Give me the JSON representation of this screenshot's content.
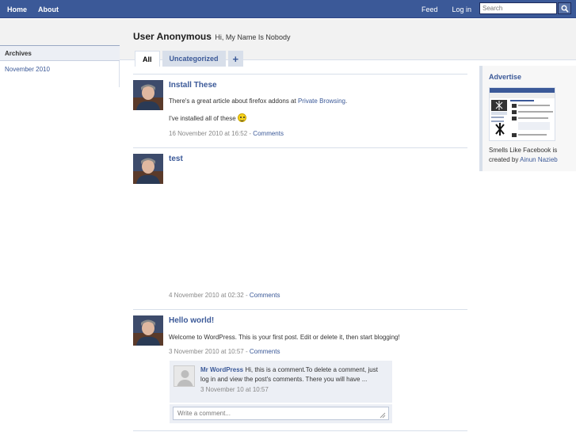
{
  "nav": {
    "home": "Home",
    "about": "About",
    "feed": "Feed",
    "login": "Log in"
  },
  "search": {
    "placeholder": "Search",
    "icon": "search-icon"
  },
  "sidebar": {
    "heading": "Archives",
    "items": [
      {
        "label": "November 2010"
      }
    ]
  },
  "profile": {
    "name": "User Anonymous",
    "tagline": "Hi, My Name Is Nobody"
  },
  "tabs": [
    {
      "label": "All",
      "active": true
    },
    {
      "label": "Uncategorized",
      "active": false
    },
    {
      "label": "+",
      "active": false
    }
  ],
  "posts": [
    {
      "title": "Install These",
      "body_prefix": "There's a great article about firefox addons at ",
      "body_link": "Private Browsing",
      "body_suffix": ".",
      "body2": "I've installed all of these",
      "date": "16 November 2010 at 16:52 - ",
      "comments_label": "Comments"
    },
    {
      "title": "test",
      "date": "4 November 2010 at 02:32 - ",
      "comments_label": "Comments"
    },
    {
      "title": "Hello world!",
      "body": "Welcome to WordPress. This is your first post. Edit or delete it, then start blogging!",
      "date": "3 November 2010 at 10:57 - ",
      "comments_label": "Comments",
      "comment": {
        "author": "Mr WordPress",
        "text": " Hi, this is a comment.To delete a comment, just log in and view the post's comments. There you will have ...",
        "date": "3 November 10 at 10:57"
      },
      "comment_input_placeholder": "Write a comment..."
    }
  ],
  "advertise": {
    "title": "Advertise",
    "text": "Smells Like Facebook is created by ",
    "author_link": "Ainun Nazieb"
  },
  "colors": {
    "brand": "#3b5998",
    "band": "#f2f2f2",
    "border": "#d8dfea"
  }
}
